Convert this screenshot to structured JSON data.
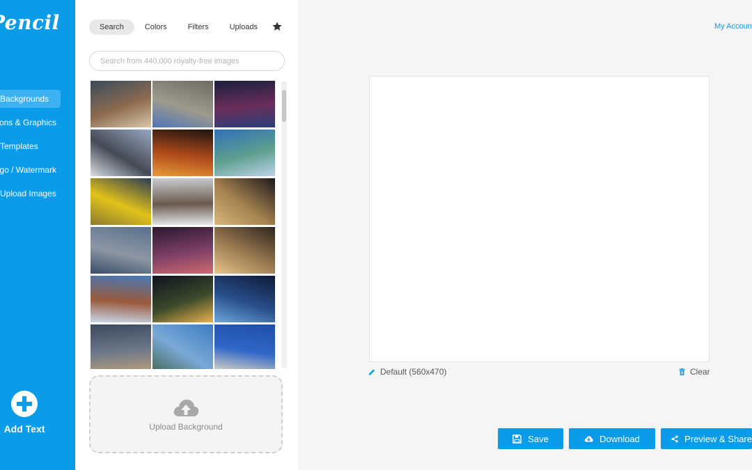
{
  "app": {
    "logo_text": "Pencil"
  },
  "sidebar": {
    "items": [
      {
        "label": "Backgrounds",
        "active": true
      },
      {
        "label": "Icons & Graphics",
        "active": false
      },
      {
        "label": "Templates",
        "active": false
      },
      {
        "label": "Logo / Watermark",
        "active": false
      },
      {
        "label": "Upload Images",
        "active": false
      }
    ],
    "add_text_label": "Add Text"
  },
  "panel": {
    "tabs": [
      {
        "label": "Search",
        "active": true
      },
      {
        "label": "Colors",
        "active": false
      },
      {
        "label": "Filters",
        "active": false
      },
      {
        "label": "Uploads",
        "active": false
      }
    ],
    "favorites_icon": "star-icon",
    "search_placeholder": "Search from 440,000 royalty-free images",
    "search_value": "",
    "thumbnails": [
      {
        "subject": "city street traffic at dusk",
        "colors": [
          "#3a4a5c",
          "#8d6b4f",
          "#d9c7a8"
        ]
      },
      {
        "subject": "stone castle tower",
        "colors": [
          "#6d6a62",
          "#9e9a8c",
          "#4c74b8"
        ]
      },
      {
        "subject": "bridge at night over water",
        "colors": [
          "#1a1f3d",
          "#6a2e5a",
          "#2a3f7a"
        ]
      },
      {
        "subject": "fisheye building plaza",
        "colors": [
          "#9aa8c2",
          "#444a55",
          "#d8dde6"
        ]
      },
      {
        "subject": "light trails on highway",
        "colors": [
          "#1b1410",
          "#b04a1a",
          "#e89a3a"
        ]
      },
      {
        "subject": "statue of liberty",
        "colors": [
          "#2e6fb8",
          "#5fa08f",
          "#bcd3e8"
        ]
      },
      {
        "subject": "yellow building steps",
        "colors": [
          "#2c3b52",
          "#e2c21b",
          "#8a7a30"
        ]
      },
      {
        "subject": "snowy street with bare trees",
        "colors": [
          "#c9ccd1",
          "#6b5a4d",
          "#e6e8ea"
        ]
      },
      {
        "subject": "city skyline at sunset",
        "colors": [
          "#1c1a1f",
          "#a5824f",
          "#d9b77c"
        ]
      },
      {
        "subject": "city waterfront with clouds",
        "colors": [
          "#5a6f8c",
          "#8c97a4",
          "#3a4d66"
        ]
      },
      {
        "subject": "city skyline at purple dusk",
        "colors": [
          "#2a1830",
          "#7e3f66",
          "#cf6a6e"
        ]
      },
      {
        "subject": "skyline at golden hour",
        "colors": [
          "#2c2620",
          "#9c7c52",
          "#e8c48a"
        ]
      },
      {
        "subject": "brooklyn bridge cables",
        "colors": [
          "#4a78b5",
          "#9a5a3c",
          "#c9d9ee"
        ]
      },
      {
        "subject": "city lights at night",
        "colors": [
          "#0d1220",
          "#3b4a2a",
          "#e8b14a"
        ]
      },
      {
        "subject": "skyline reflection at night",
        "colors": [
          "#101a35",
          "#284f8c",
          "#6ea7d9"
        ]
      },
      {
        "subject": "storm clouds over houses",
        "colors": [
          "#3c4a5e",
          "#6b7788",
          "#b59d7e"
        ]
      },
      {
        "subject": "statue of liberty close-up",
        "colors": [
          "#3b7cc4",
          "#7aa9d6",
          "#466c5c"
        ]
      },
      {
        "subject": "dome against blue sky",
        "colors": [
          "#1f4ea8",
          "#2f67c8",
          "#d8d2c4"
        ]
      }
    ],
    "upload_label": "Upload Background"
  },
  "header": {
    "account_label": "My Account"
  },
  "canvas": {
    "size_label": "Default (560x470)",
    "clear_label": "Clear"
  },
  "actions": {
    "save_label": "Save",
    "download_label": "Download",
    "share_label": "Preview & Share"
  },
  "colors": {
    "accent": "#0a9be9",
    "accent_light": "#3db2f2",
    "workspace_bg": "#f5f5f5"
  }
}
